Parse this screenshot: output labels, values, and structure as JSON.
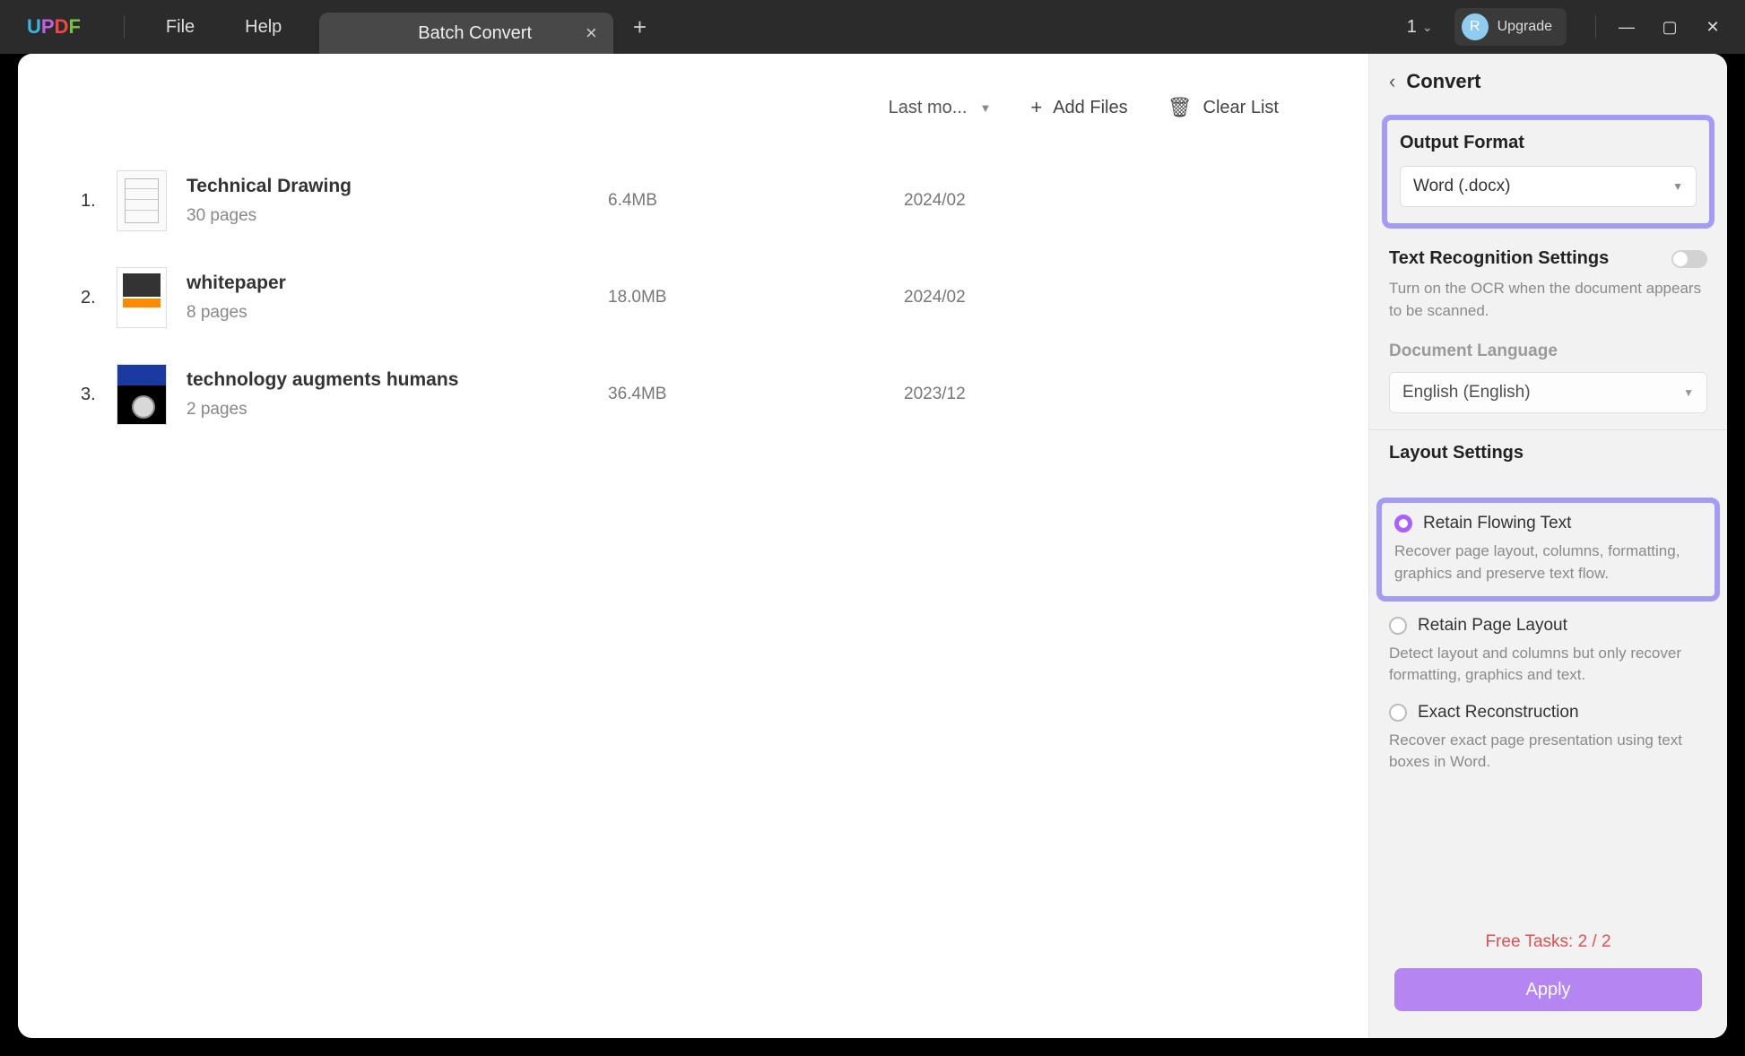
{
  "titlebar": {
    "menus": {
      "file": "File",
      "help": "Help"
    },
    "tab": "Batch Convert",
    "count": "1",
    "upgrade": "Upgrade",
    "avatar": "R"
  },
  "toolbar": {
    "sort": "Last mo...",
    "add": "Add Files",
    "clear": "Clear List"
  },
  "files": [
    {
      "idx": "1.",
      "name": "Technical Drawing",
      "pages": "30 pages",
      "size": "6.4MB",
      "date": "2024/02"
    },
    {
      "idx": "2.",
      "name": "whitepaper",
      "pages": "8 pages",
      "size": "18.0MB",
      "date": "2024/02"
    },
    {
      "idx": "3.",
      "name": "technology augments humans",
      "pages": "2 pages",
      "size": "36.4MB",
      "date": "2023/12"
    }
  ],
  "sidebar": {
    "title": "Convert",
    "output": {
      "label": "Output Format",
      "value": "Word (.docx)"
    },
    "ocr": {
      "label": "Text Recognition Settings",
      "hint": "Turn on the OCR when the document appears to be scanned.",
      "langlabel": "Document Language",
      "lang": "English (English)"
    },
    "layout": {
      "label": "Layout Settings",
      "opt1": {
        "label": "Retain Flowing Text",
        "desc": "Recover page layout, columns, formatting, graphics and preserve text flow."
      },
      "opt2": {
        "label": "Retain Page Layout",
        "desc": "Detect layout and columns but only recover formatting, graphics and text."
      },
      "opt3": {
        "label": "Exact Reconstruction",
        "desc": "Recover exact page presentation using text boxes in Word."
      }
    },
    "free": "Free Tasks: 2 / 2",
    "apply": "Apply"
  }
}
